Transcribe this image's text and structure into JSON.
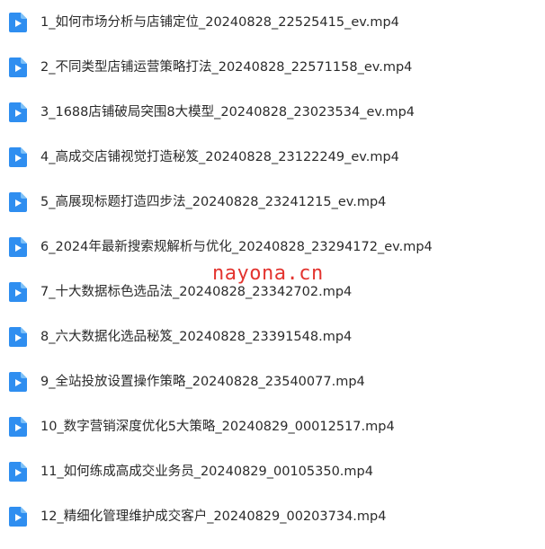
{
  "colors": {
    "icon_blue": "#2f8ef0",
    "icon_light": "#7cc0f7",
    "text": "#2a2a2a",
    "watermark": "#e3342f"
  },
  "icon_name": "video-file-icon",
  "files": [
    {
      "name": "1_如何市场分析与店铺定位_20240828_22525415_ev.mp4"
    },
    {
      "name": "2_不同类型店铺运营策略打法_20240828_22571158_ev.mp4"
    },
    {
      "name": "3_1688店铺破局突围8大模型_20240828_23023534_ev.mp4"
    },
    {
      "name": "4_高成交店铺视觉打造秘笈_20240828_23122249_ev.mp4"
    },
    {
      "name": "5_高展现标题打造四步法_20240828_23241215_ev.mp4"
    },
    {
      "name": "6_2024年最新搜索规解析与优化_20240828_23294172_ev.mp4"
    },
    {
      "name": "7_十大数据标色选品法_20240828_23342702.mp4"
    },
    {
      "name": "8_六大数据化选品秘笈_20240828_23391548.mp4"
    },
    {
      "name": "9_全站投放设置操作策略_20240828_23540077.mp4"
    },
    {
      "name": "10_数字营销深度优化5大策略_20240829_00012517.mp4"
    },
    {
      "name": "11_如何练成高成交业务员_20240829_00105350.mp4"
    },
    {
      "name": "12_精细化管理维护成交客户_20240829_00203734.mp4"
    }
  ],
  "watermark": {
    "text": "nayona.cn"
  }
}
